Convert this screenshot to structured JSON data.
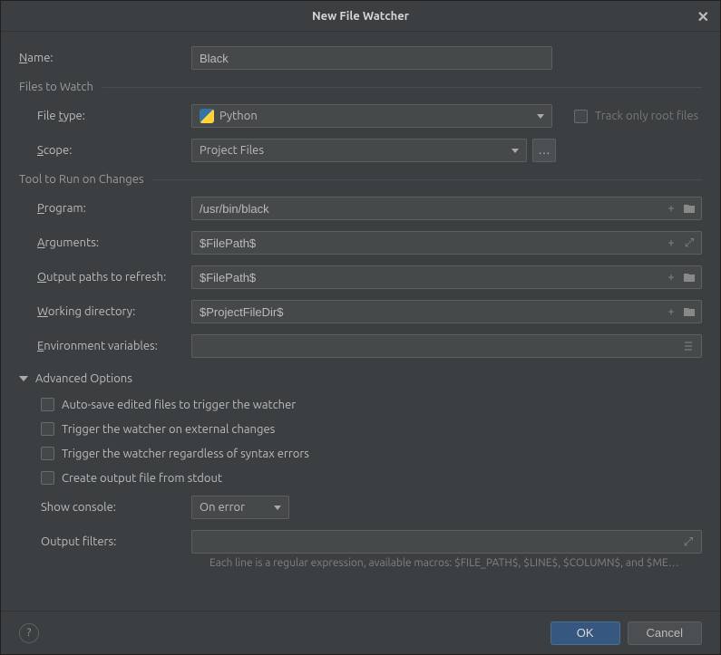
{
  "title": "New File Watcher",
  "name": {
    "label_pre": "N",
    "label_post": "ame:",
    "value": "Black"
  },
  "files_header": "Files to Watch",
  "file_type": {
    "label_pre": "File ",
    "label_ul": "t",
    "label_post": "ype:",
    "value": "Python"
  },
  "track_root": "Track only root files",
  "scope": {
    "label_ul": "S",
    "label_post": "cope:",
    "value": "Project Files"
  },
  "tool_header": "Tool to Run on Changes",
  "program": {
    "label_ul": "P",
    "label_post": "rogram:",
    "value": "/usr/bin/black"
  },
  "arguments": {
    "label_ul": "A",
    "label_post": "rguments:",
    "value": "$FilePath$"
  },
  "output_paths": {
    "label_ul": "O",
    "label_post": "utput paths to refresh:",
    "value": "$FilePath$"
  },
  "working_dir": {
    "label_ul": "W",
    "label_post": "orking directory:",
    "value": "$ProjectFileDir$"
  },
  "env_vars": {
    "label_ul": "E",
    "label_post": "nvironment variables:"
  },
  "advanced_header": "Advanced Options",
  "adv": {
    "autosave": "Auto-save edited files to trigger the watcher",
    "external": "Trigger the watcher on external changes",
    "syntax": "Trigger the watcher regardless of syntax errors",
    "stdout": "Create output file from stdout"
  },
  "show_console": {
    "label": "Show console:",
    "value": "On error"
  },
  "output_filters": {
    "label": "Output filters:"
  },
  "hint": "Each line is a regular expression, available macros: $FILE_PATH$, $LINE$, $COLUMN$, and $ME…",
  "buttons": {
    "ok": "OK",
    "cancel": "Cancel"
  }
}
